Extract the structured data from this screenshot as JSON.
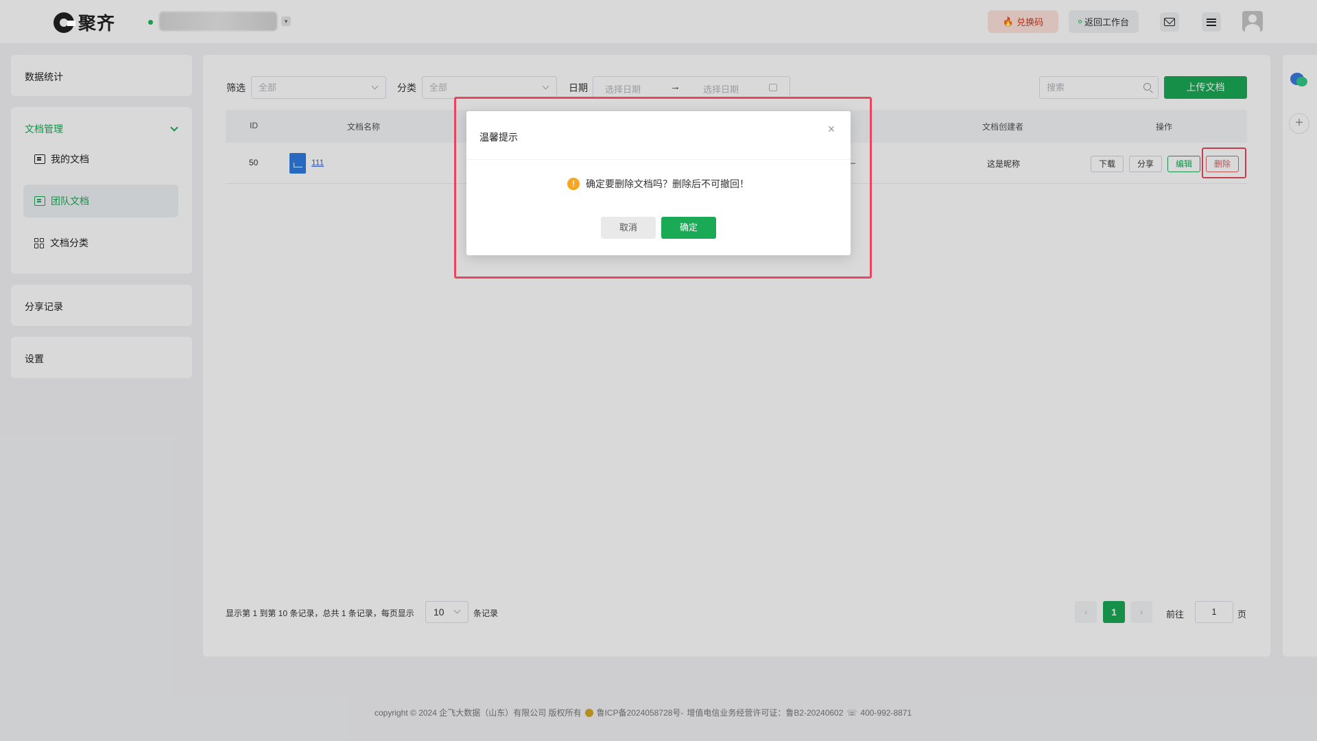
{
  "header": {
    "logo_text": "聚齐",
    "redeem_label": "兑换码",
    "back_label": "返回工作台"
  },
  "sidebar": {
    "stats": "数据统计",
    "docs_manage": "文档管理",
    "my_docs": "我的文档",
    "team_docs": "团队文档",
    "doc_category": "文档分类",
    "share_records": "分享记录",
    "settings": "设置"
  },
  "filters": {
    "filter_label": "筛选",
    "filter_value": "全部",
    "category_label": "分类",
    "category_value": "全部",
    "date_label": "日期",
    "date_start": "选择日期",
    "date_arrow": "→",
    "date_end": "选择日期",
    "search_placeholder": "搜索",
    "upload_label": "上传文档"
  },
  "table": {
    "headers": {
      "id": "ID",
      "name": "文档名称",
      "col_fragment": ":",
      "creator": "文档创建者",
      "actions": "操作"
    },
    "rows": [
      {
        "id": "50",
        "name": "111",
        "col_fragment": "—",
        "creator": "这是昵称",
        "download": "下载",
        "share": "分享",
        "edit": "编辑",
        "delete": "删除"
      }
    ]
  },
  "pagination": {
    "info": "显示第 1 到第 10 条记录，总共 1 条记录，每页显示",
    "page_size": "10",
    "unit": "条记录",
    "prev": "‹",
    "current": "1",
    "next": "›",
    "goto_label": "前往",
    "goto_value": "1",
    "page_label": "页"
  },
  "footer": {
    "copyright": "copyright © 2024 企飞大数据（山东）有限公司 版权所有",
    "icp": "鲁ICP备2024058728号-",
    "license": "增值电信业务经营许可证：鲁B2-20240602",
    "phone": "400-992-8871"
  },
  "dialog": {
    "title": "温馨提示",
    "close": "×",
    "warn_glyph": "!",
    "message": "确定要删除文档吗？删除后不可撤回！",
    "cancel": "取消",
    "ok": "确定"
  },
  "colors": {
    "primary": "#1aaa55",
    "highlight": "#e8465f",
    "warning": "#f5a623"
  }
}
